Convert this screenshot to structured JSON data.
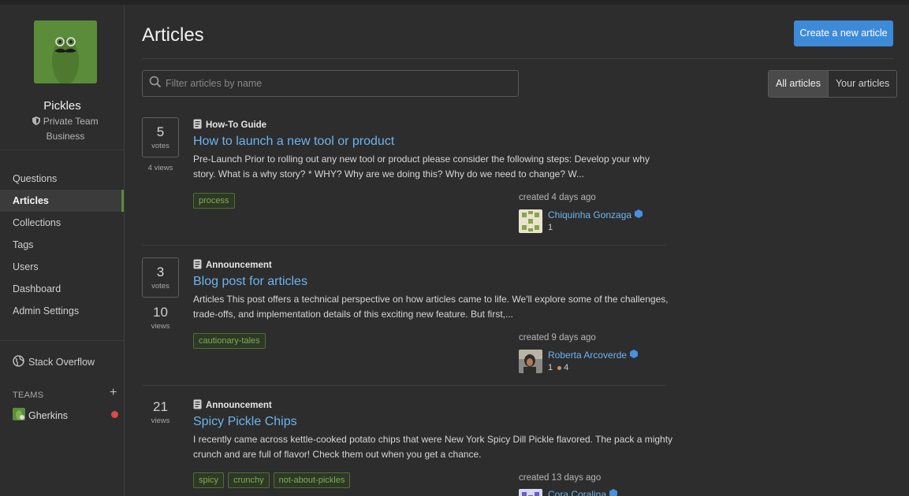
{
  "sidebar": {
    "team_name": "Pickles",
    "team_visibility": "Private Team",
    "team_plan": "Business",
    "nav": [
      "Questions",
      "Articles",
      "Collections",
      "Tags",
      "Users",
      "Dashboard",
      "Admin Settings"
    ],
    "active_nav": "Articles",
    "stack_overflow": "Stack Overflow",
    "teams_label": "TEAMS",
    "teams_add": "+",
    "teams": [
      "Gherkins"
    ]
  },
  "header": {
    "title": "Articles",
    "create_button": "Create a new article"
  },
  "filter": {
    "placeholder": "Filter articles by name",
    "toggle_all": "All articles",
    "toggle_yours": "Your articles"
  },
  "articles": [
    {
      "votes": "5",
      "votes_label": "votes",
      "views": "4 views",
      "type": "How-To Guide",
      "title": "How to launch a new tool or product",
      "excerpt": "Pre-Launch Prior to rolling out any new tool or product please consider the following steps: Develop your why story. What is a why story? * WHY? Why are we doing this? Why do we need to change? W...",
      "tags": [
        "process"
      ],
      "created": "created 4 days ago",
      "author": "Chiquinha Gonzaga",
      "rep": "1",
      "badges": ""
    },
    {
      "votes": "3",
      "votes_label": "votes",
      "views_num": "10",
      "views_label": "views",
      "type": "Announcement",
      "title": "Blog post for articles",
      "excerpt": "Articles This post offers a technical perspective on how articles came to life. We'll explore some of the challenges, trade-offs, and implementation details of this exciting new feature. But first,...",
      "tags": [
        "cautionary-tales"
      ],
      "created": "created 9 days ago",
      "author": "Roberta Arcoverde",
      "rep": "1",
      "badges": "4"
    },
    {
      "views_num": "21",
      "views_label": "views",
      "type": "Announcement",
      "title": "Spicy Pickle Chips",
      "excerpt": "I recently came across kettle-cooked potato chips that were New York Spicy Dill Pickle flavored. The pack a mighty crunch and are full of flavor! Check them out when you get a chance.",
      "tags": [
        "spicy",
        "crunchy",
        "not-about-pickles"
      ],
      "created": "created 13 days ago",
      "author": "Cora Coralina"
    }
  ],
  "colors": {
    "accent_blue": "#3d8ad8",
    "link_blue": "#6cb4f0",
    "team_green": "#5b8c3a",
    "background": "#2d2d2d"
  }
}
